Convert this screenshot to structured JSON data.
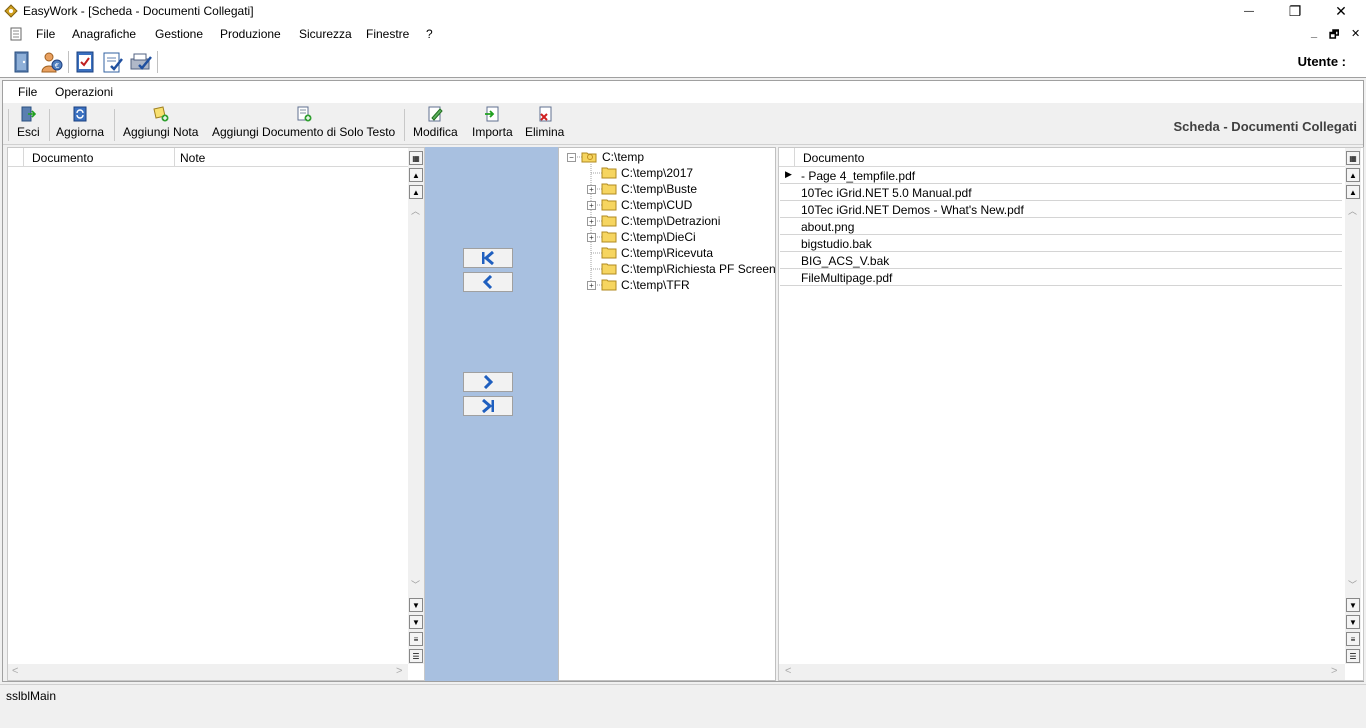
{
  "window": {
    "title": "EasyWork - [Scheda - Documenti Collegati]",
    "minimize": "—",
    "restore": "❐",
    "close": "✕"
  },
  "menubar": {
    "items": [
      {
        "label": "File"
      },
      {
        "label": "Anagrafiche"
      },
      {
        "label": "Gestione"
      },
      {
        "label": "Produzione"
      },
      {
        "label": "Sicurezza"
      },
      {
        "label": "Finestre"
      },
      {
        "label": "?"
      }
    ],
    "mdi_minimize": "_",
    "mdi_restore": "🗗",
    "mdi_close": "✕"
  },
  "toolbar": {
    "utente_label": "Utente :"
  },
  "child": {
    "menu": [
      {
        "label": "File"
      },
      {
        "label": "Operazioni"
      }
    ],
    "buttons": [
      {
        "label": "Esci"
      },
      {
        "label": "Aggiorna"
      },
      {
        "label": "Aggiungi Nota"
      },
      {
        "label": "Aggiungi Documento di Solo Testo"
      },
      {
        "label": "Modifica"
      },
      {
        "label": "Importa"
      },
      {
        "label": "Elimina"
      }
    ],
    "title": "Scheda - Documenti Collegati"
  },
  "leftgrid": {
    "columns": [
      "Documento",
      "Note"
    ]
  },
  "tree": {
    "root": "C:\\temp",
    "children": [
      {
        "label": "C:\\temp\\2017",
        "expandable": false
      },
      {
        "label": "C:\\temp\\Buste",
        "expandable": true
      },
      {
        "label": "C:\\temp\\CUD",
        "expandable": true
      },
      {
        "label": "C:\\temp\\Detrazioni",
        "expandable": true
      },
      {
        "label": "C:\\temp\\DieCi",
        "expandable": true
      },
      {
        "label": "C:\\temp\\Ricevuta",
        "expandable": false
      },
      {
        "label": "C:\\temp\\Richiesta PF Screen",
        "expandable": false
      },
      {
        "label": "C:\\temp\\TFR",
        "expandable": true
      }
    ]
  },
  "rightgrid": {
    "column": "Documento",
    "rows": [
      " - Page 4_tempfile.pdf",
      "10Tec iGrid.NET 5.0 Manual.pdf",
      "10Tec iGrid.NET Demos - What's New.pdf",
      "about.png",
      "bigstudio.bak",
      "BIG_ACS_V.bak",
      "FileMultipage.pdf"
    ]
  },
  "statusbar": {
    "text": "sslblMain"
  },
  "colors": {
    "blue_panel": "#a8c0e0",
    "icon_blue": "#1f5fbf"
  }
}
